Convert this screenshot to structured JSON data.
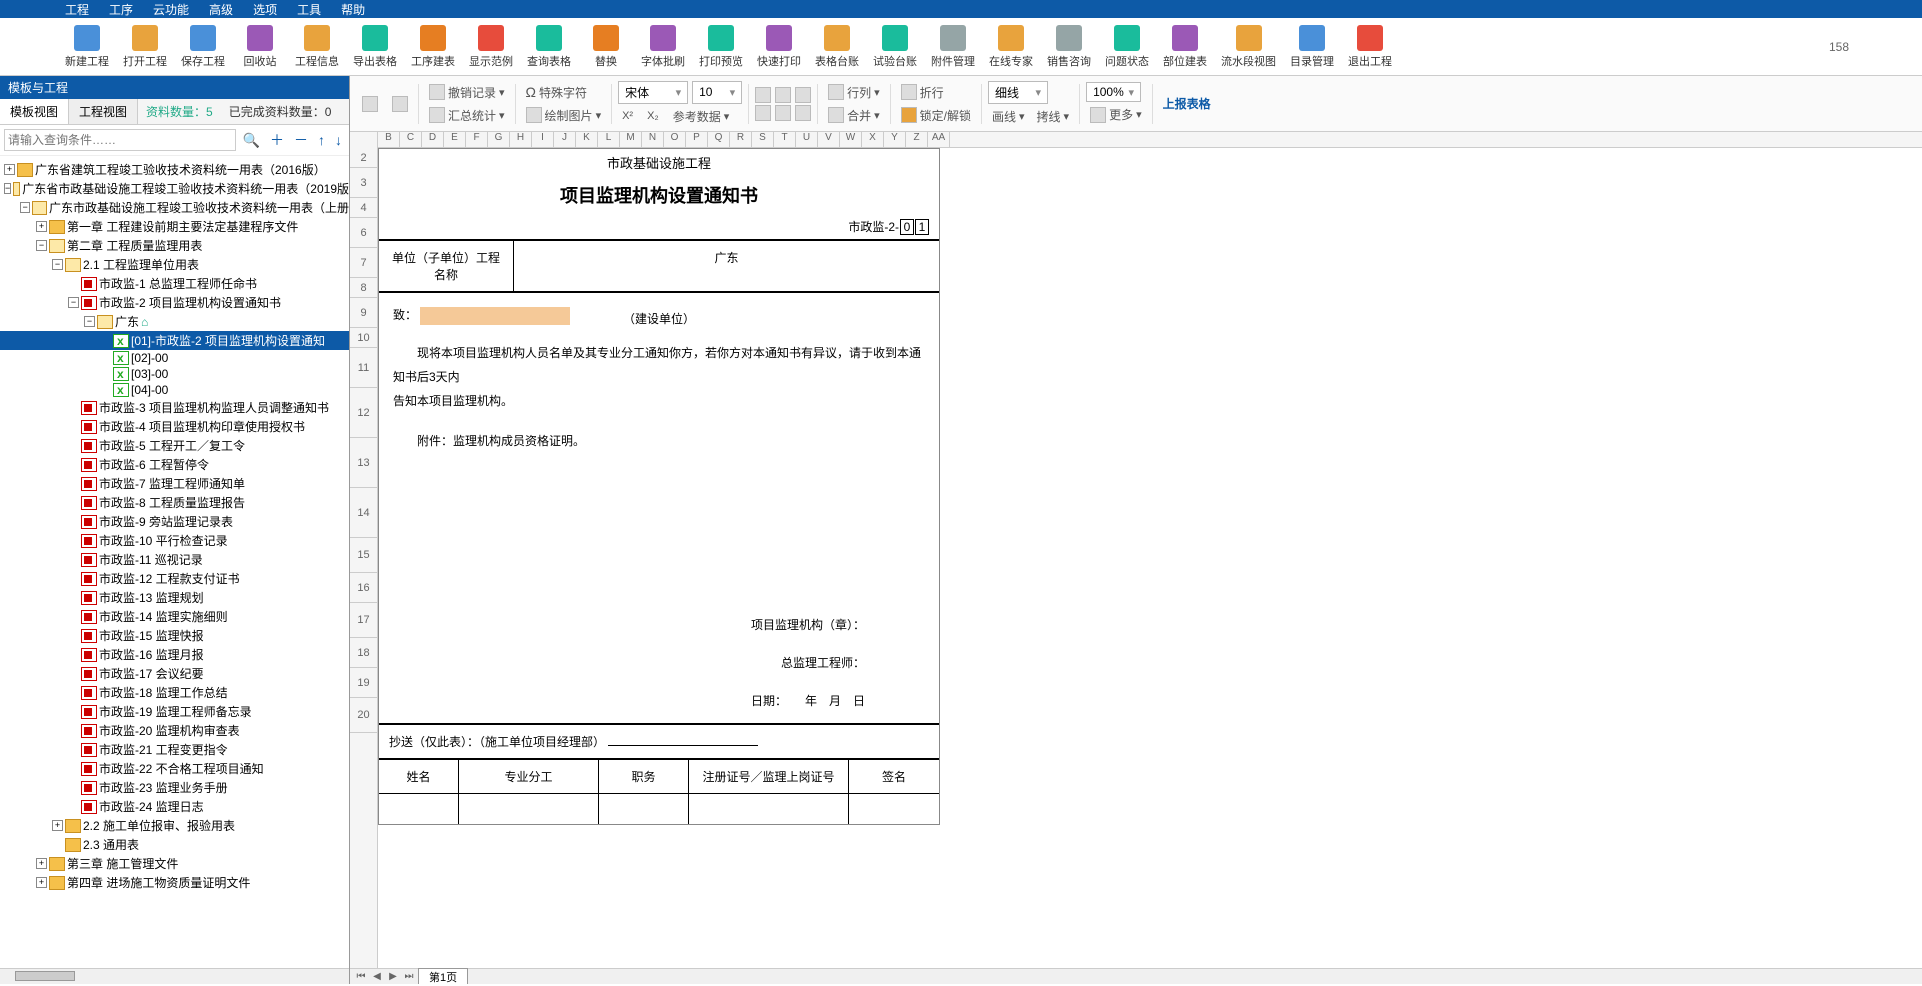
{
  "menu": [
    "工程",
    "工序",
    "云功能",
    "高级",
    "选项",
    "工具",
    "帮助"
  ],
  "toolbar": [
    {
      "label": "新建工程",
      "color": "#4a90d9"
    },
    {
      "label": "打开工程",
      "color": "#e8a33d"
    },
    {
      "label": "保存工程",
      "color": "#4a90d9"
    },
    {
      "label": "回收站",
      "color": "#9b59b6"
    },
    {
      "label": "工程信息",
      "color": "#e8a33d"
    },
    {
      "label": "导出表格",
      "color": "#1abc9c"
    },
    {
      "label": "工序建表",
      "color": "#e67e22"
    },
    {
      "label": "显示范例",
      "color": "#e74c3c"
    },
    {
      "label": "查询表格",
      "color": "#1abc9c"
    },
    {
      "label": "替换",
      "color": "#e67e22"
    },
    {
      "label": "字体批刷",
      "color": "#9b59b6"
    },
    {
      "label": "打印预览",
      "color": "#1abc9c"
    },
    {
      "label": "快速打印",
      "color": "#9b59b6"
    },
    {
      "label": "表格台账",
      "color": "#e8a33d"
    },
    {
      "label": "试验台账",
      "color": "#1abc9c"
    },
    {
      "label": "附件管理",
      "color": "#95a5a6"
    },
    {
      "label": "在线专家",
      "color": "#e8a33d"
    },
    {
      "label": "销售咨询",
      "color": "#95a5a6"
    },
    {
      "label": "问题状态",
      "color": "#1abc9c"
    },
    {
      "label": "部位建表",
      "color": "#9b59b6"
    },
    {
      "label": "流水段视图",
      "color": "#e8a33d"
    },
    {
      "label": "目录管理",
      "color": "#4a90d9"
    },
    {
      "label": "退出工程",
      "color": "#e74c3c"
    }
  ],
  "status_num": "158",
  "panel_title": "模板与工程",
  "tabs": {
    "t1": "模板视图",
    "t2": "工程视图",
    "stat1": "资料数量：5",
    "stat2": "已完成资料数量：0"
  },
  "search_ph": "请输入查询条件……",
  "tree": {
    "r1": "广东省建筑工程竣工验收技术资料统一用表（2016版）",
    "r2": "广东省市政基础设施工程竣工验收技术资料统一用表（2019版",
    "r3": "广东市政基础设施工程竣工验收技术资料统一用表（上册",
    "ch1": "第一章 工程建设前期主要法定基建程序文件",
    "ch2": "第二章 工程质量监理用表",
    "s21": "2.1 工程监理单位用表",
    "n1": "市政监-1 总监理工程师任命书",
    "n2": "市政监-2 项目监理机构设置通知书",
    "gd": "广东",
    "sel": "[01]-市政监-2 项目监理机构设置通知",
    "i02": "[02]-00",
    "i03": "[03]-00",
    "i04": "[04]-00",
    "n3": "市政监-3 项目监理机构监理人员调整通知书",
    "n4": "市政监-4 项目监理机构印章使用授权书",
    "n5": "市政监-5 工程开工／复工令",
    "n6": "市政监-6 工程暂停令",
    "n7": "市政监-7 监理工程师通知单",
    "n8": "市政监-8 工程质量监理报告",
    "n9": "市政监-9 旁站监理记录表",
    "n10": "市政监-10 平行检查记录",
    "n11": "市政监-11 巡视记录",
    "n12": "市政监-12 工程款支付证书",
    "n13": "市政监-13 监理规划",
    "n14": "市政监-14 监理实施细则",
    "n15": "市政监-15 监理快报",
    "n16": "市政监-16 监理月报",
    "n17": "市政监-17 会议纪要",
    "n18": "市政监-18 监理工作总结",
    "n19": "市政监-19 监理工程师备忘录",
    "n20": "市政监-20 监理机构审查表",
    "n21": "市政监-21 工程变更指令",
    "n22": "市政监-22 不合格工程项目通知",
    "n23": "市政监-23 监理业务手册",
    "n24": "市政监-24 监理日志",
    "s22": "2.2 施工单位报审、报验用表",
    "s23": "2.3 通用表",
    "ch3": "第三章 施工管理文件",
    "ch4": "第四章 进场施工物资质量证明文件"
  },
  "ribbon": {
    "undo": "撤销记录",
    "special": "特殊字符",
    "font": "宋体",
    "size": "10",
    "row": "行列",
    "wrap": "折行",
    "sum": "汇总统计",
    "pic": "绘制图片",
    "ref": "参考数据",
    "merge": "合并",
    "lock": "锁定/解锁",
    "line1": "细线",
    "line2": "画线",
    "line3": "拷线",
    "zoom": "100%",
    "more": "更多",
    "upload": "上报表格"
  },
  "cols": [
    "B",
    "C",
    "D",
    "E",
    "F",
    "G",
    "H",
    "I",
    "J",
    "K",
    "L",
    "M",
    "N",
    "O",
    "P",
    "Q",
    "R",
    "S",
    "T",
    "U",
    "V",
    "W",
    "X",
    "Y",
    "Z",
    "AA"
  ],
  "rows": [
    "2",
    "3",
    "4",
    "6",
    "7",
    "8",
    "9",
    "10",
    "11",
    "12",
    "13",
    "14",
    "15",
    "16",
    "17",
    "18",
    "19",
    "20"
  ],
  "doc": {
    "t1": "市政基础设施工程",
    "t2": "项目监理机构设置通知书",
    "code_prefix": "市政监-2-",
    "code_d1": "0",
    "code_d2": "1",
    "unit_label": "单位（子单位）工程名称",
    "unit_val": "广东",
    "to": "致：",
    "build": "（建设单位）",
    "body1": "现将本项目监理机构人员名单及其专业分工通知你方，若你方对本通知书有异议，请于收到本通知书后3天内",
    "body2": "告知本项目监理机构。",
    "attach": "附件：监理机构成员资格证明。",
    "org": "项目监理机构（章）：",
    "eng": "总监理工程师：",
    "date": "日期：",
    "date_fmt": "年　月　日",
    "cc": "抄送（仅此表）：（施工单位项目经理部）",
    "th1": "姓名",
    "th2": "专业分工",
    "th3": "职务",
    "th4": "注册证号／监理上岗证号",
    "th5": "签名"
  },
  "sheet_tab": "第1页"
}
